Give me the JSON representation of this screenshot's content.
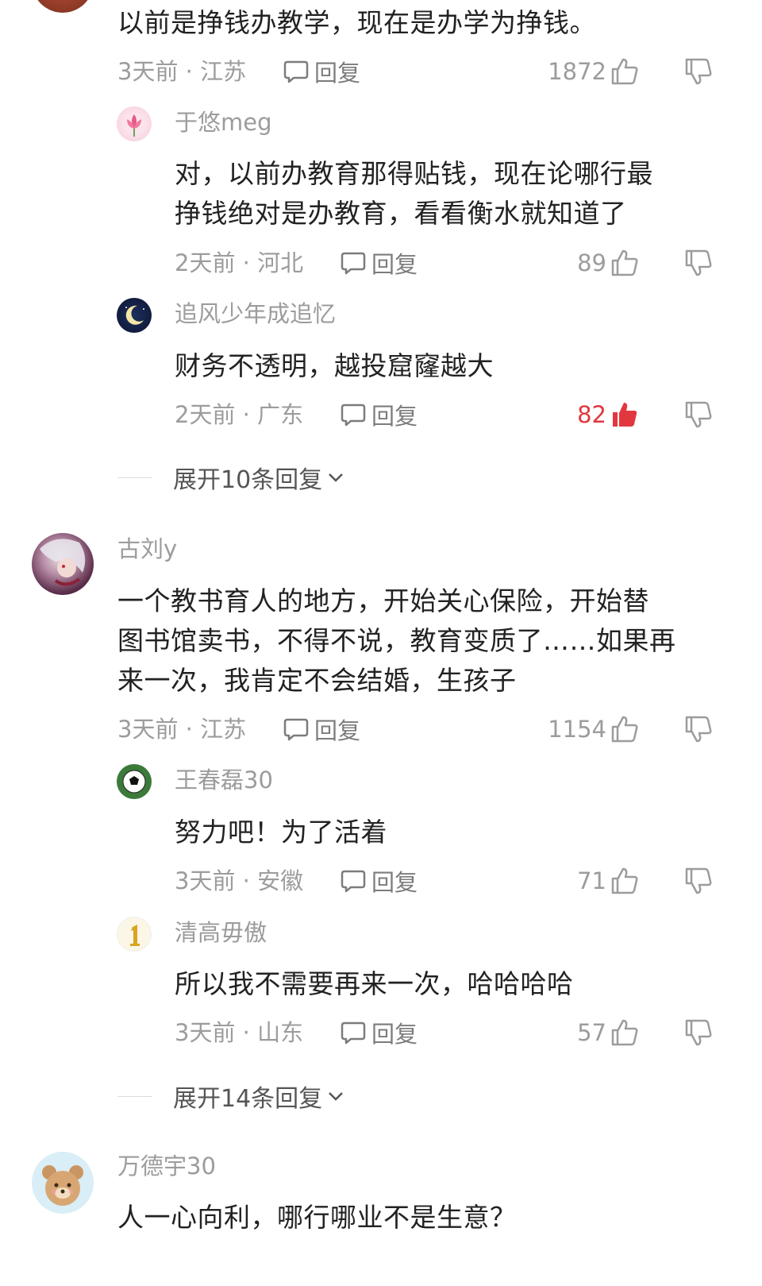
{
  "comments": [
    {
      "text_lines": [
        "以前是挣钱办教学，现在是办学为挣钱。"
      ],
      "meta": "3天前 · 江苏",
      "reply_label": "回复",
      "likes": "1872",
      "liked": false,
      "replies": [
        {
          "name": "于悠meg",
          "text_lines": [
            "对，以前办教育那得贴钱，现在论哪行最",
            "挣钱绝对是办教育，看看衡水就知道了"
          ],
          "meta": "2天前 · 河北",
          "reply_label": "回复",
          "likes": "89",
          "liked": false
        },
        {
          "name": "追风少年成追忆",
          "text_lines": [
            "财务不透明，越投窟窿越大"
          ],
          "meta": "2天前 · 广东",
          "reply_label": "回复",
          "likes": "82",
          "liked": true
        }
      ],
      "expand_label": "展开10条回复"
    },
    {
      "name": "古刘y",
      "text_lines": [
        "一个教书育人的地方，开始关心保险，开始替",
        "图书馆卖书，不得不说，教育变质了……如果再",
        "来一次，我肯定不会结婚，生孩子"
      ],
      "meta": "3天前 · 江苏",
      "reply_label": "回复",
      "likes": "1154",
      "liked": false,
      "replies": [
        {
          "name": "王春磊30",
          "text_lines": [
            "努力吧！为了活着"
          ],
          "meta": "3天前 · 安徽",
          "reply_label": "回复",
          "likes": "71",
          "liked": false
        },
        {
          "name": "清高毋傲",
          "text_lines": [
            "所以我不需要再来一次，哈哈哈哈"
          ],
          "meta": "3天前 · 山东",
          "reply_label": "回复",
          "likes": "57",
          "liked": false
        }
      ],
      "expand_label": "展开14条回复"
    },
    {
      "name": "万德宇30",
      "text_lines": [
        "人一心向利，哪行哪业不是生意？"
      ]
    }
  ],
  "colors": {
    "accent_red": "#e2373f",
    "meta_gray": "#9c9c9c",
    "text_dark": "#222222"
  },
  "icons": [
    "comment-bubble-icon",
    "thumb-up-icon",
    "thumb-down-icon",
    "chevron-down-icon"
  ]
}
